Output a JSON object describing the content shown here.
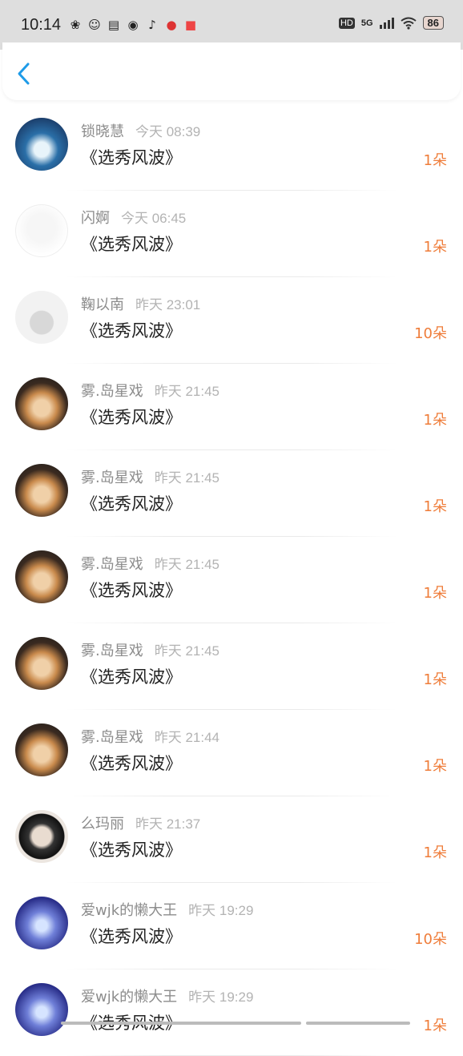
{
  "status_bar": {
    "time": "10:14",
    "network": "5G",
    "hd": "HD",
    "battery": "86"
  },
  "header": {
    "back_icon": "chevron-left-icon"
  },
  "list": [
    {
      "name": "锁晓慧",
      "time": "今天 08:39",
      "title": "《选秀风波》",
      "amount": "1朵",
      "avatar": "av-blue"
    },
    {
      "name": "闪婀",
      "time": "今天 06:45",
      "title": "《选秀风波》",
      "amount": "1朵",
      "avatar": "av-white"
    },
    {
      "name": "鞠以南",
      "time": "昨天 23:01",
      "title": "《选秀风波》",
      "amount": "10朵",
      "avatar": "av-hamster"
    },
    {
      "name": "雾.岛星戏",
      "time": "昨天 21:45",
      "title": "《选秀风波》",
      "amount": "1朵",
      "avatar": "av-dog"
    },
    {
      "name": "雾.岛星戏",
      "time": "昨天 21:45",
      "title": "《选秀风波》",
      "amount": "1朵",
      "avatar": "av-dog"
    },
    {
      "name": "雾.岛星戏",
      "time": "昨天 21:45",
      "title": "《选秀风波》",
      "amount": "1朵",
      "avatar": "av-dog"
    },
    {
      "name": "雾.岛星戏",
      "time": "昨天 21:45",
      "title": "《选秀风波》",
      "amount": "1朵",
      "avatar": "av-dog"
    },
    {
      "name": "雾.岛星戏",
      "time": "昨天 21:44",
      "title": "《选秀风波》",
      "amount": "1朵",
      "avatar": "av-dog"
    },
    {
      "name": "么玛丽",
      "time": "昨天 21:37",
      "title": "《选秀风波》",
      "amount": "1朵",
      "avatar": "av-man"
    },
    {
      "name": "爱wjk的懒大王",
      "time": "昨天 19:29",
      "title": "《选秀风波》",
      "amount": "10朵",
      "avatar": "av-stage"
    },
    {
      "name": "爱wjk的懒大王",
      "time": "昨天 19:29",
      "title": "《选秀风波》",
      "amount": "1朵",
      "avatar": "av-stage"
    }
  ],
  "colors": {
    "accent": "#ef7d3a",
    "back": "#1e9be8"
  }
}
